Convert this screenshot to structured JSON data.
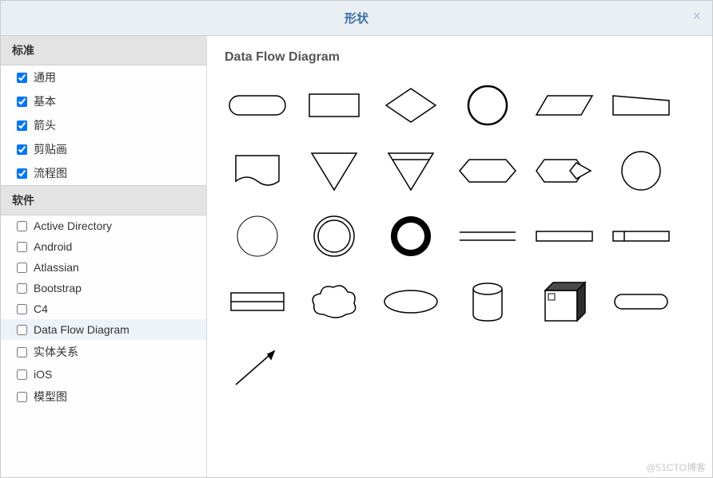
{
  "dialog": {
    "title": "形状",
    "close_symbol": "×"
  },
  "sidebar": {
    "sections": [
      {
        "header": "标准",
        "items": [
          {
            "id": "general",
            "label": "通用",
            "checked": true,
            "selected": false
          },
          {
            "id": "basic",
            "label": "基本",
            "checked": true,
            "selected": false
          },
          {
            "id": "arrows",
            "label": "箭头",
            "checked": true,
            "selected": false
          },
          {
            "id": "clipart",
            "label": "剪贴画",
            "checked": true,
            "selected": false
          },
          {
            "id": "flowchart",
            "label": "流程图",
            "checked": true,
            "selected": false
          }
        ]
      },
      {
        "header": "软件",
        "items": [
          {
            "id": "ad",
            "label": "Active Directory",
            "checked": false,
            "selected": false
          },
          {
            "id": "android",
            "label": "Android",
            "checked": false,
            "selected": false
          },
          {
            "id": "atlassian",
            "label": "Atlassian",
            "checked": false,
            "selected": false
          },
          {
            "id": "bootstrap",
            "label": "Bootstrap",
            "checked": false,
            "selected": false
          },
          {
            "id": "c4",
            "label": "C4",
            "checked": false,
            "selected": false
          },
          {
            "id": "dfd",
            "label": "Data Flow Diagram",
            "checked": false,
            "selected": true
          },
          {
            "id": "er",
            "label": "实体关系",
            "checked": false,
            "selected": false
          },
          {
            "id": "ios",
            "label": "iOS",
            "checked": false,
            "selected": false
          },
          {
            "id": "mockup",
            "label": "模型图",
            "checked": false,
            "selected": false
          }
        ]
      }
    ]
  },
  "preview": {
    "title": "Data Flow Diagram",
    "shapes": [
      "rounded-rect",
      "rectangle",
      "diamond",
      "circle-bold",
      "parallelogram",
      "trapezoid",
      "document",
      "triangle-down",
      "triangle-band",
      "hexagon",
      "hex-overlap",
      "circle",
      "circle-thin",
      "circle-double",
      "ring-thick",
      "two-lines",
      "long-rect",
      "split-rect",
      "half-rect",
      "cloud",
      "ellipse",
      "cylinder",
      "cube",
      "stadium",
      "arrow"
    ]
  },
  "watermark": "@51CTO博客"
}
